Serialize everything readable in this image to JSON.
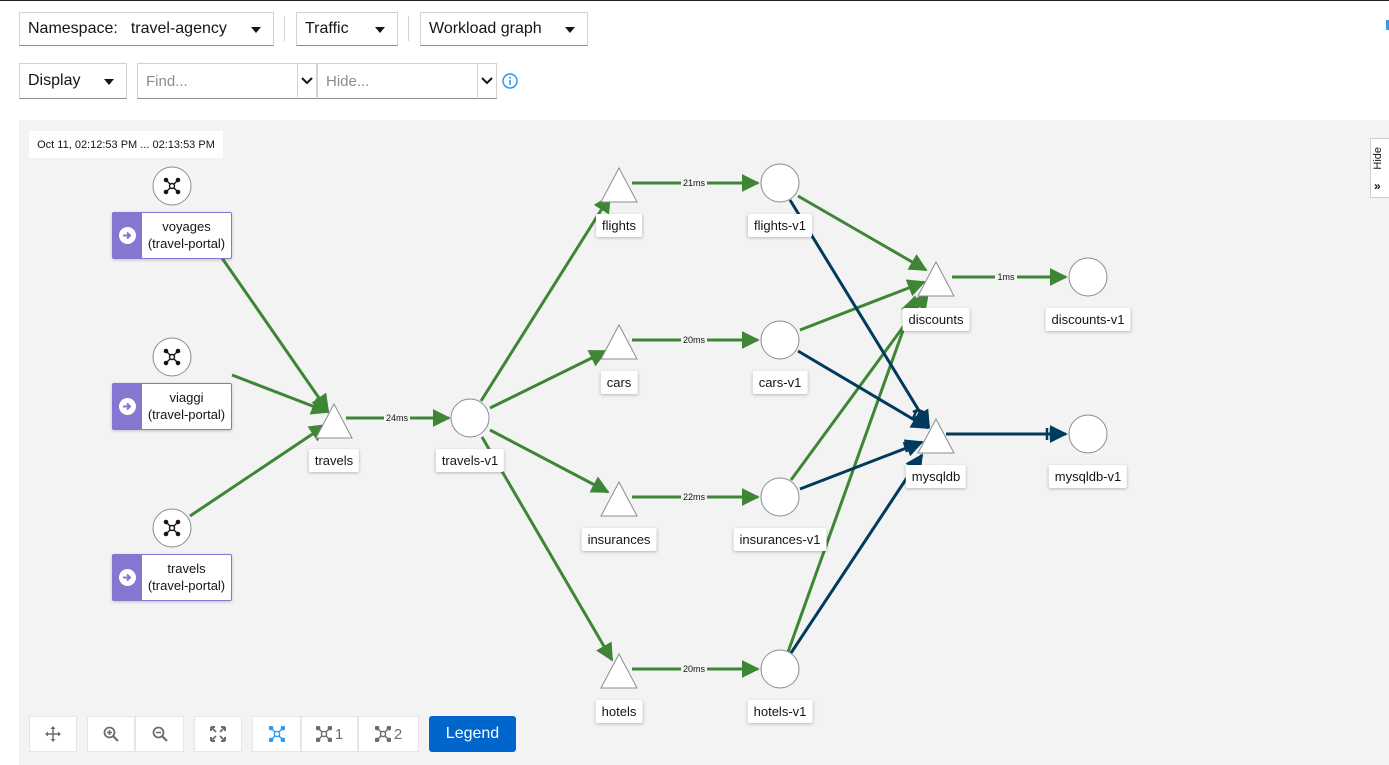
{
  "toolbar": {
    "namespace_label": "Namespace:",
    "namespace_value": "travel-agency",
    "traffic_label": "Traffic",
    "graph_type_label": "Workload graph",
    "display_label": "Display",
    "find_placeholder": "Find...",
    "hide_placeholder": "Hide..."
  },
  "graph": {
    "timestamp": "Oct 11, 02:12:53 PM ... 02:13:53 PM",
    "hide_panel_label": "Hide",
    "apps": [
      {
        "name": "voyages",
        "namespace": "(travel-portal)"
      },
      {
        "name": "viaggi",
        "namespace": "(travel-portal)"
      },
      {
        "name": "travels",
        "namespace": "(travel-portal)"
      }
    ],
    "nodes": {
      "travels_svc": "travels",
      "travels_v1": "travels-v1",
      "flights": "flights",
      "cars": "cars",
      "insurances": "insurances",
      "hotels": "hotels",
      "flights_v1": "flights-v1",
      "cars_v1": "cars-v1",
      "insurances_v1": "insurances-v1",
      "hotels_v1": "hotels-v1",
      "discounts": "discounts",
      "mysqldb": "mysqldb",
      "discounts_v1": "discounts-v1",
      "mysqldb_v1": "mysqldb-v1"
    },
    "edge_labels": {
      "travels_to_v1": "24ms",
      "flights": "21ms",
      "cars": "20ms",
      "insurances": "22ms",
      "hotels": "20ms",
      "discounts": "1ms"
    }
  },
  "bottom_toolbar": {
    "namespace_layout_1": "1",
    "namespace_layout_2": "2",
    "legend_label": "Legend"
  },
  "colors": {
    "healthy_edge": "#3e8635",
    "tcp_edge": "#003a5c",
    "accent": "#0066cc",
    "app_box": "#8476d1",
    "graph_background": "#f3f3f3"
  }
}
